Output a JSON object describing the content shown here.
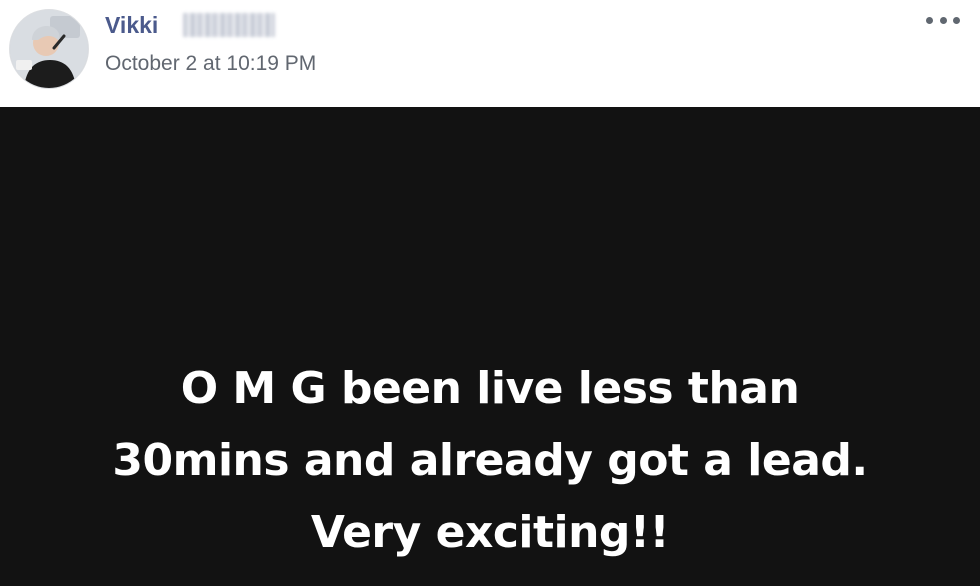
{
  "post": {
    "author_name": "Vikki",
    "timestamp": "October 2 at 10:19 PM",
    "more_icon": "more-options-icon",
    "status_lines": [
      "O M G been live less than",
      "30mins and already got a lead.",
      "Very exciting!!"
    ]
  },
  "colors": {
    "author_name": "#4b5a8c",
    "timestamp": "#616770",
    "status_background": "#121212",
    "status_text": "#ffffff"
  }
}
